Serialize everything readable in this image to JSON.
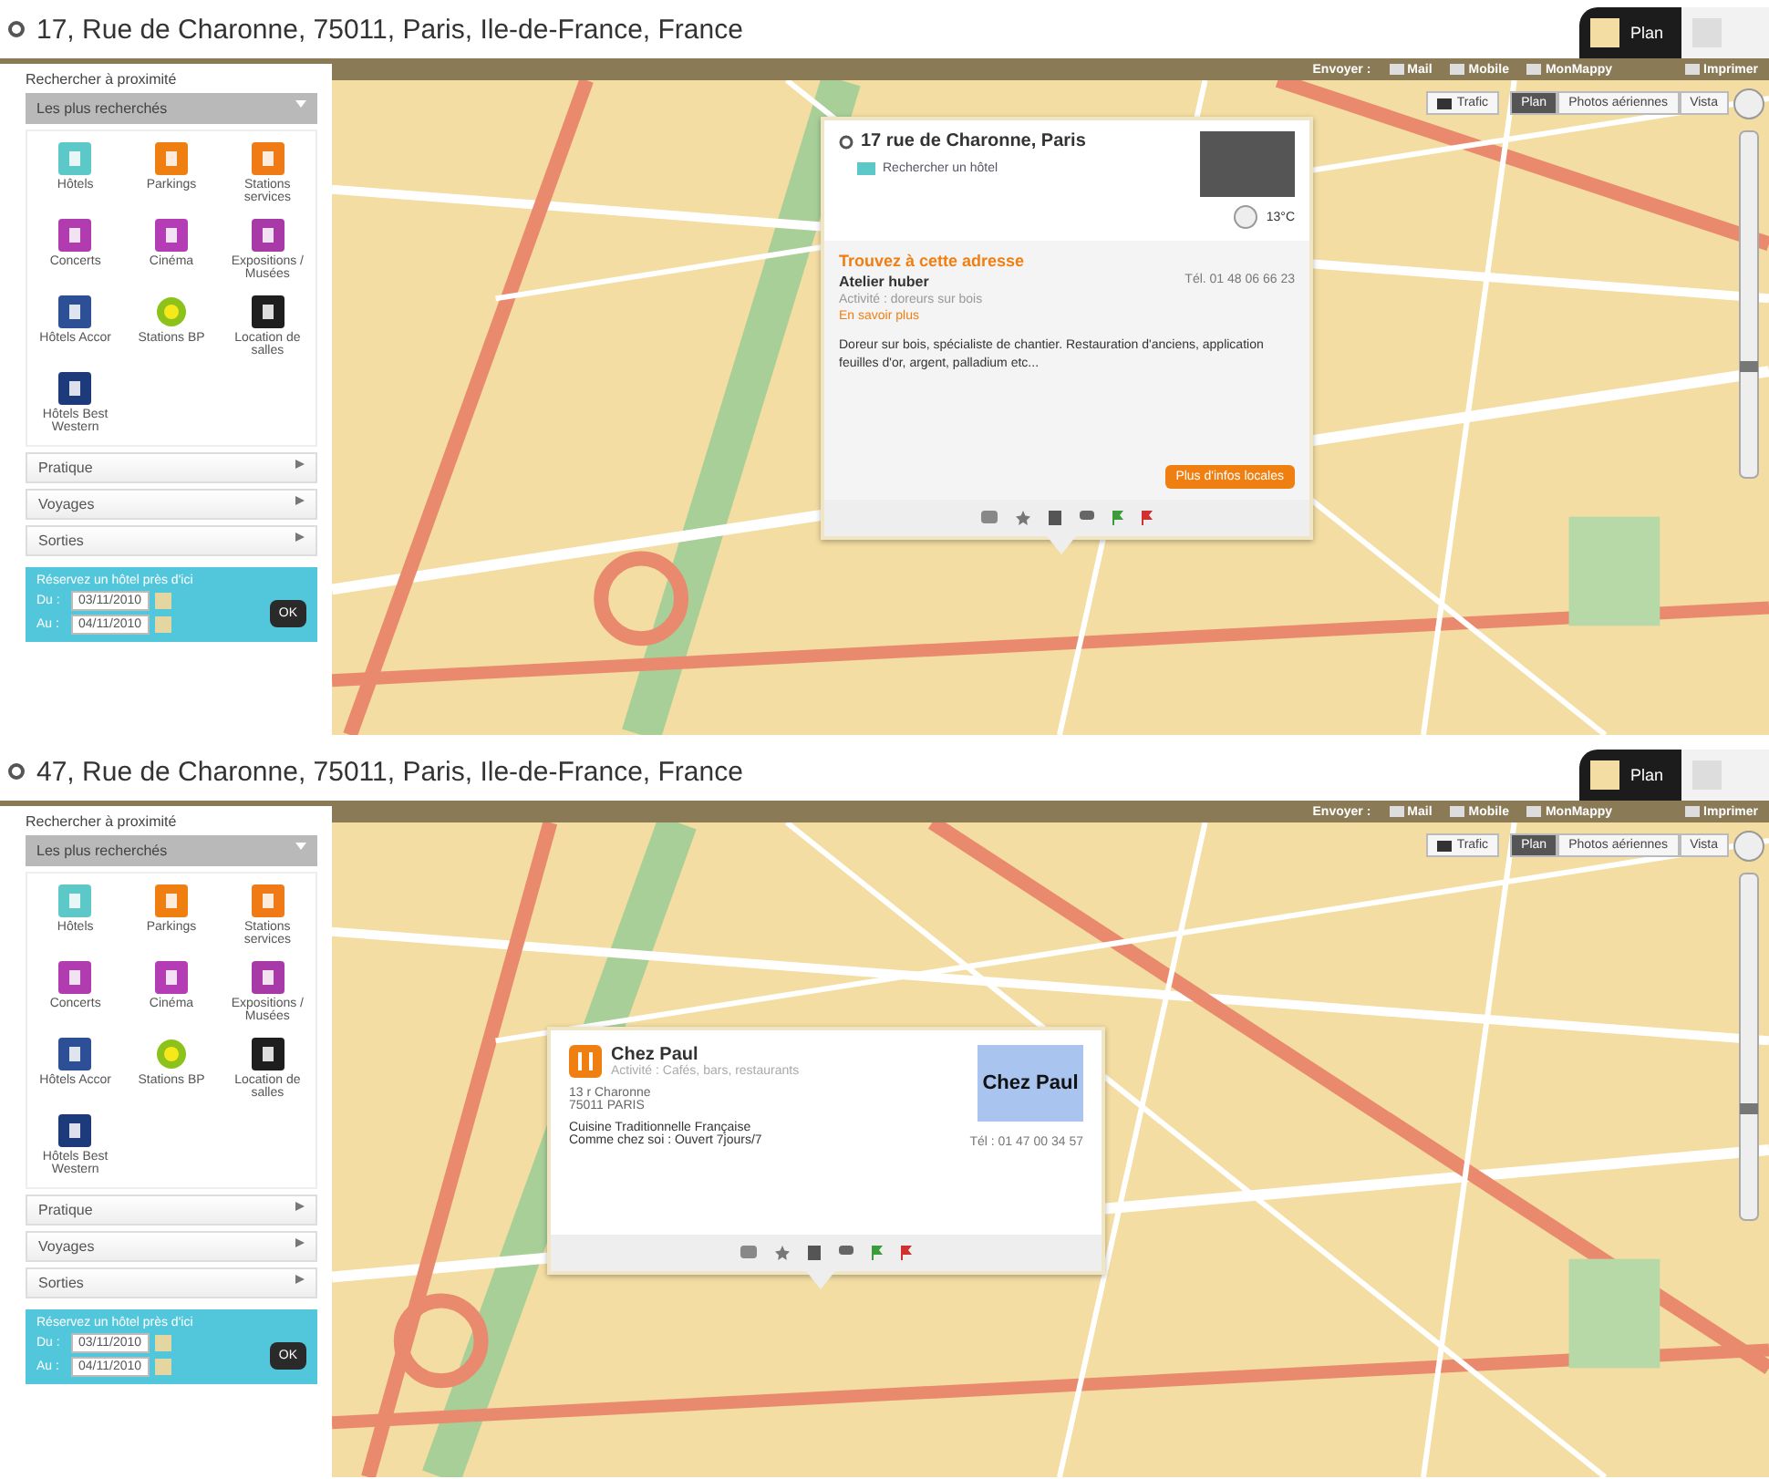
{
  "panels": [
    {
      "address": "17, Rue de Charonne, 75011, Paris, Ile-de-France, France",
      "view_tabs": [
        {
          "label": "Plan",
          "selected": true
        },
        {
          "selected": false
        }
      ],
      "toolbar": {
        "send_label": "Envoyer :",
        "share": [
          "Mail",
          "Mobile",
          "MonMappy"
        ],
        "print": "Imprimer"
      },
      "map_controls": {
        "traffic": "Trafic",
        "layers": [
          {
            "label": "Plan",
            "selected": true
          },
          {
            "label": "Photos aériennes",
            "selected": false
          },
          {
            "label": "Vista",
            "selected": false
          }
        ]
      },
      "sidebar": {
        "title": "Rechercher à proximité",
        "section": "Les plus recherchés",
        "items": [
          {
            "label": "Hôtels",
            "kind": "tile",
            "color": "#5cc8c8"
          },
          {
            "label": "Parkings",
            "kind": "tile",
            "color": "#f07f12"
          },
          {
            "label": "Stations services",
            "kind": "tile",
            "color": "#f07a16"
          },
          {
            "label": "Concerts",
            "kind": "tile",
            "color": "#b03cb0"
          },
          {
            "label": "Cinéma",
            "kind": "tile",
            "color": "#b43cb4"
          },
          {
            "label": "Expositions / Musées",
            "kind": "tile",
            "color": "#a83aa8"
          },
          {
            "label": "Hôtels Accor",
            "kind": "tile",
            "color": "#2d4f95"
          },
          {
            "label": "Stations BP",
            "kind": "ring",
            "color": "#8cc21a"
          },
          {
            "label": "Location de salles",
            "kind": "tile",
            "color": "#1e1e1e"
          },
          {
            "label": "Hôtels Best Western",
            "kind": "tile",
            "color": "#1d3a7a"
          }
        ],
        "groups": [
          "Pratique",
          "Voyages",
          "Sorties"
        ],
        "booking": {
          "title": "Réservez un hôtel près d'ici",
          "from_label": "Du :",
          "from": "03/11/2010",
          "to_label": "Au :",
          "to": "04/11/2010",
          "ok": "OK"
        }
      },
      "popup": {
        "kind": "address",
        "title": "17 rue de Charonne, Paris",
        "link": "Rechercher un hôtel",
        "temperature": "13°C",
        "heading": "Trouvez à cette adresse",
        "business": "Atelier huber",
        "phone": "Tél. 01 48 06 66 23",
        "activity": "Activité : doreurs sur bois",
        "more": "En savoir plus",
        "description": "Doreur sur bois, spécialiste de chantier. Restauration d'anciens, application feuilles d'or, argent, palladium etc...",
        "button": "Plus d'infos locales"
      }
    },
    {
      "address": "47, Rue de Charonne, 75011, Paris, Ile-de-France, France",
      "view_tabs": [
        {
          "label": "Plan",
          "selected": true
        },
        {
          "selected": false
        }
      ],
      "toolbar": {
        "send_label": "Envoyer :",
        "share": [
          "Mail",
          "Mobile",
          "MonMappy"
        ],
        "print": "Imprimer"
      },
      "map_controls": {
        "traffic": "Trafic",
        "layers": [
          {
            "label": "Plan",
            "selected": true
          },
          {
            "label": "Photos aériennes",
            "selected": false
          },
          {
            "label": "Vista",
            "selected": false
          }
        ]
      },
      "sidebar": {
        "title": "Rechercher à proximité",
        "section": "Les plus recherchés",
        "items": [
          {
            "label": "Hôtels",
            "kind": "tile",
            "color": "#5cc8c8"
          },
          {
            "label": "Parkings",
            "kind": "tile",
            "color": "#f07f12"
          },
          {
            "label": "Stations services",
            "kind": "tile",
            "color": "#f07a16"
          },
          {
            "label": "Concerts",
            "kind": "tile",
            "color": "#b03cb0"
          },
          {
            "label": "Cinéma",
            "kind": "tile",
            "color": "#b43cb4"
          },
          {
            "label": "Expositions / Musées",
            "kind": "tile",
            "color": "#a83aa8"
          },
          {
            "label": "Hôtels Accor",
            "kind": "tile",
            "color": "#2d4f95"
          },
          {
            "label": "Stations BP",
            "kind": "ring",
            "color": "#8cc21a"
          },
          {
            "label": "Location de salles",
            "kind": "tile",
            "color": "#1e1e1e"
          },
          {
            "label": "Hôtels Best Western",
            "kind": "tile",
            "color": "#1d3a7a"
          }
        ],
        "groups": [
          "Pratique",
          "Voyages",
          "Sorties"
        ],
        "booking": {
          "title": "Réservez un hôtel près d'ici",
          "from_label": "Du :",
          "from": "03/11/2010",
          "to_label": "Au :",
          "to": "04/11/2010",
          "ok": "OK"
        }
      },
      "popup": {
        "kind": "place",
        "title": "Chez Paul",
        "activity": "Activité : Cafés, bars, restaurants",
        "address_lines": [
          "13 r Charonne",
          "75011 PARIS"
        ],
        "description_lines": [
          "Cuisine Traditionnelle Française",
          "Comme chez soi : Ouvert 7jours/7"
        ],
        "logo": "Chez Paul",
        "phone": "Tél : 01 47 00 34 57"
      }
    }
  ]
}
